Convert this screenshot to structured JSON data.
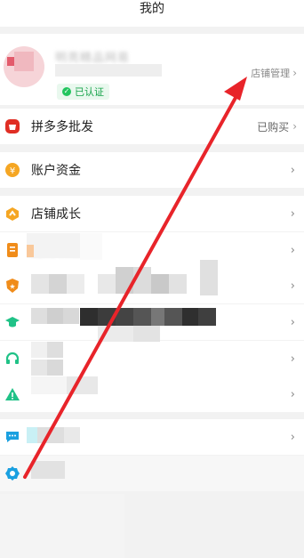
{
  "header": {
    "title": "我的"
  },
  "profile": {
    "shop_name": "明亮精品网易",
    "verified_label": "已认证",
    "manage_label": "店铺管理"
  },
  "menu": [
    {
      "label": "拼多多批发",
      "right_text": "已购买",
      "icon": "wholesale-icon",
      "color": "#e02e24"
    },
    {
      "label": "账户资金",
      "right_text": "",
      "icon": "yuan-coin-icon",
      "color": "#f5a623"
    },
    {
      "label": "店铺成长",
      "right_text": "",
      "icon": "growth-icon",
      "color": "#f5a623"
    },
    {
      "label": "能力认证",
      "right_text": "",
      "icon": "document-icon",
      "color": "#f08c1a"
    },
    {
      "label": "",
      "right_text": "",
      "icon": "shield-star-icon",
      "color": "#f08c1a"
    },
    {
      "label": "",
      "right_text": "",
      "icon": "graduation-cap-icon",
      "color": "#20c287"
    },
    {
      "label": "",
      "right_text": "",
      "icon": "headset-icon",
      "color": "#20c287"
    },
    {
      "label": "",
      "right_text": "",
      "icon": "warning-icon",
      "color": "#20c287"
    },
    {
      "label": "",
      "right_text": "",
      "icon": "chat-bubble-icon",
      "color": "#1aa0e0"
    },
    {
      "label": "",
      "right_text": "",
      "icon": "settings-gear-icon",
      "color": "#1aa0e0"
    }
  ],
  "colors": {
    "annotation_arrow": "#e8242a"
  }
}
